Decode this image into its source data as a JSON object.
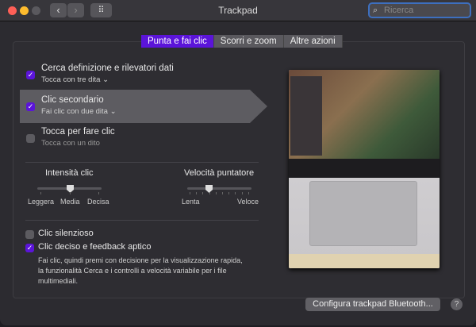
{
  "window": {
    "title": "Trackpad",
    "search_placeholder": "Ricerca"
  },
  "tabs": [
    {
      "label": "Punta e fai clic",
      "selected": true
    },
    {
      "label": "Scorri e zoom",
      "selected": false
    },
    {
      "label": "Altre azioni",
      "selected": false
    }
  ],
  "options": [
    {
      "label": "Cerca definizione e rilevatori dati",
      "sub": "Tocca con tre dita",
      "checked": true
    },
    {
      "label": "Clic secondario",
      "sub": "Fai clic con due dita",
      "checked": true
    },
    {
      "label": "Tocca per fare clic",
      "sub": "Tocca con un dito",
      "checked": false
    }
  ],
  "sliders": {
    "click": {
      "title": "Intensità clic",
      "labels": [
        "Leggera",
        "Media",
        "Decisa"
      ],
      "value": "Media"
    },
    "speed": {
      "title": "Velocità puntatore",
      "min_label": "Lenta",
      "max_label": "Veloce",
      "value_fraction": 0.35
    }
  },
  "bottom_options": [
    {
      "label": "Clic silenzioso",
      "checked": false
    },
    {
      "label": "Clic deciso e feedback aptico",
      "checked": true,
      "desc": [
        "Fai clic, quindi premi con decisione per la visualizzazione rapida,",
        "la funzionalità Cerca e i controlli a velocità variabile per i file",
        "multimediali."
      ]
    }
  ],
  "buttons": {
    "bluetooth": "Configura trackpad Bluetooth...",
    "help": "?",
    "check": "✓",
    "chevron": "⌄",
    "back": "‹",
    "forward": "›",
    "grid": "⠿"
  },
  "colors": {
    "accent": "#5b14d9"
  }
}
